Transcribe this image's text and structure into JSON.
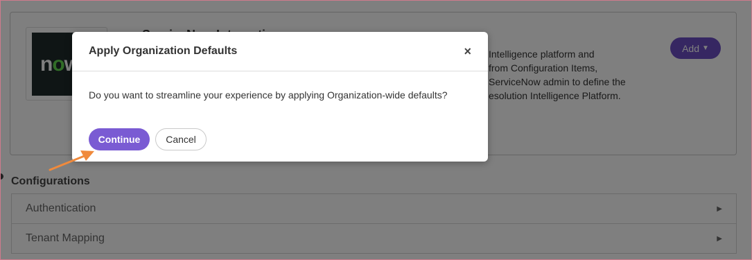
{
  "integration": {
    "logo_text_1": "n",
    "logo_text_2": "o",
    "logo_text_3": "w",
    "title": "ServiceNow Integration",
    "description_lines": [
      "Intelligence platform and",
      "from Configuration Items,",
      "ServiceNow admin to define the",
      "esolution Intelligence Platform."
    ],
    "add_label": "Add",
    "add_caret": "▼"
  },
  "configurations": {
    "title": "Configurations",
    "items": [
      {
        "label": "Authentication",
        "chevron": "▶"
      },
      {
        "label": "Tenant Mapping",
        "chevron": "▶"
      }
    ]
  },
  "modal": {
    "title": "Apply Organization Defaults",
    "close": "×",
    "message": "Do you want to streamline your experience by applying Organization-wide defaults?",
    "continue_label": "Continue",
    "cancel_label": "Cancel"
  },
  "colors": {
    "accent": "#7a5bd3",
    "add_button": "#6c4fc4",
    "arrow": "#f08a3c"
  },
  "icons": {
    "close": "close-icon",
    "caret": "caret-down-icon",
    "chevron": "chevron-right-icon",
    "pointer": "arrow-annotation-icon"
  }
}
